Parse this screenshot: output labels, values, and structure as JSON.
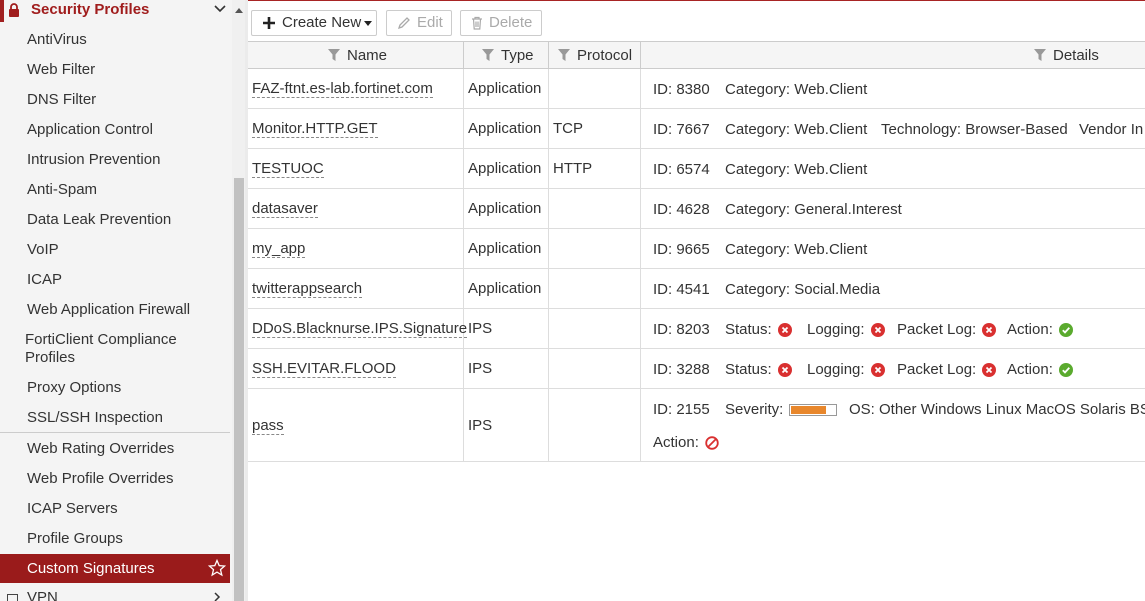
{
  "sidebar": {
    "section_title": "Security Profiles",
    "items": [
      {
        "label": "AntiVirus"
      },
      {
        "label": "Web Filter"
      },
      {
        "label": "DNS Filter"
      },
      {
        "label": "Application Control"
      },
      {
        "label": "Intrusion Prevention"
      },
      {
        "label": "Anti-Spam"
      },
      {
        "label": "Data Leak Prevention"
      },
      {
        "label": "VoIP"
      },
      {
        "label": "ICAP"
      },
      {
        "label": "Web Application Firewall"
      },
      {
        "label": "FortiClient Compliance Profiles"
      },
      {
        "label": "Proxy Options"
      },
      {
        "label": "SSL/SSH Inspection"
      },
      {
        "label": "Web Rating Overrides"
      },
      {
        "label": "Web Profile Overrides"
      },
      {
        "label": "ICAP Servers"
      },
      {
        "label": "Profile Groups"
      },
      {
        "label": "Custom Signatures"
      }
    ],
    "next_section": "VPN",
    "accent_color": "#9a1b1b"
  },
  "toolbar": {
    "create_label": "Create New",
    "edit_label": "Edit",
    "delete_label": "Delete"
  },
  "table": {
    "columns": [
      "Name",
      "Type",
      "Protocol",
      "Details"
    ],
    "rows": [
      {
        "name": "FAZ-ftnt.es-lab.fortinet.com",
        "type": "Application",
        "protocol": "",
        "id": "ID: 8380",
        "category": "Category: Web.Client"
      },
      {
        "name": "Monitor.HTTP.GET",
        "type": "Application",
        "protocol": "TCP",
        "id": "ID: 7667",
        "category": "Category: Web.Client",
        "technology": "Technology: Browser-Based",
        "vendor": "Vendor In"
      },
      {
        "name": "TESTUOC",
        "type": "Application",
        "protocol": "HTTP",
        "id": "ID: 6574",
        "category": "Category: Web.Client"
      },
      {
        "name": "datasaver",
        "type": "Application",
        "protocol": "",
        "id": "ID: 4628",
        "category": "Category: General.Interest"
      },
      {
        "name": "my_app",
        "type": "Application",
        "protocol": "",
        "id": "ID: 9665",
        "category": "Category: Web.Client"
      },
      {
        "name": "twitterappsearch",
        "type": "Application",
        "protocol": "",
        "id": "ID: 4541",
        "category": "Category: Social.Media"
      },
      {
        "name": "DDoS.Blacknurse.IPS.Signature",
        "type": "IPS",
        "protocol": "",
        "id": "ID: 8203",
        "status": "Status:",
        "logging": "Logging:",
        "packet_log": "Packet Log:",
        "action": "Action:"
      },
      {
        "name": "SSH.EVITAR.FLOOD",
        "type": "IPS",
        "protocol": "",
        "id": "ID: 3288",
        "status": "Status:",
        "logging": "Logging:",
        "packet_log": "Packet Log:",
        "action": "Action:"
      },
      {
        "name": "pass",
        "type": "IPS",
        "protocol": "",
        "id": "ID: 2155",
        "severity": "Severity:",
        "severity_level": 0.8,
        "os": "OS: Other Windows Linux MacOS Solaris BSD",
        "action": "Action:"
      }
    ]
  },
  "colors": {
    "status_error": "#d93030",
    "status_ok": "#5aaa2e",
    "severity_fill": "#e8872c"
  }
}
